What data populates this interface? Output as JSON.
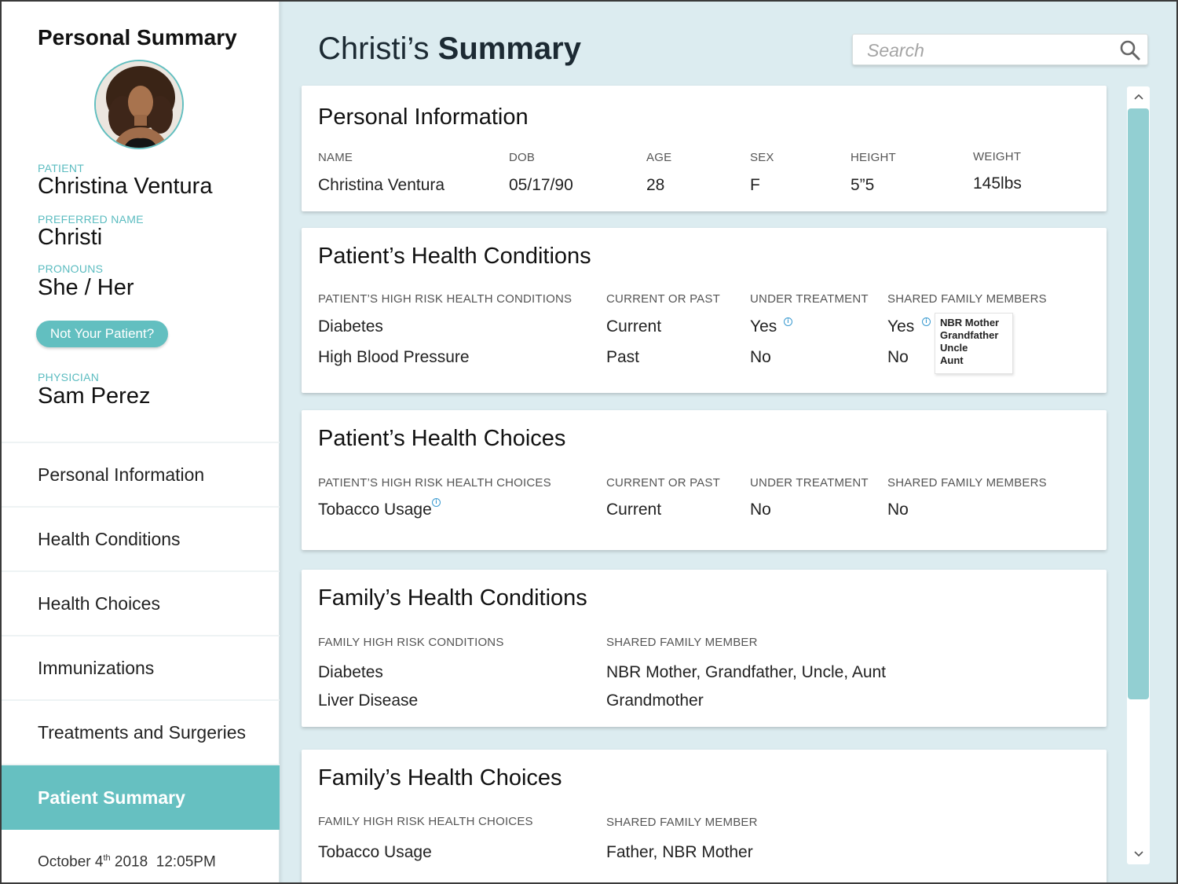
{
  "sidebar": {
    "title": "Personal Summary",
    "patient_label": "PATIENT",
    "patient_name": "Christina Ventura",
    "preferred_label": "PREFERRED NAME",
    "preferred_name": "Christi",
    "pronouns_label": "PRONOUNS",
    "pronouns": "She / Her",
    "not_your_patient": "Not Your Patient?",
    "physician_label": "PHYSICIAN",
    "physician": "Sam Perez",
    "nav": [
      {
        "label": "Personal Information",
        "active": false
      },
      {
        "label": "Health Conditions",
        "active": false
      },
      {
        "label": "Health Choices",
        "active": false
      },
      {
        "label": "Immunizations",
        "active": false
      },
      {
        "label": "Treatments and Surgeries",
        "active": false
      },
      {
        "label": "Patient Summary",
        "active": true
      }
    ],
    "timestamp": {
      "month": "October",
      "day": "4",
      "day_suffix": "th",
      "year": "2018",
      "time": "12:05PM"
    }
  },
  "header": {
    "title_prefix": "Christi’s",
    "title_bold": "Summary",
    "search_placeholder": "Search"
  },
  "personal_info": {
    "title": "Personal Information",
    "headers": [
      "NAME",
      "DOB",
      "AGE",
      "SEX",
      "HEIGHT",
      "WEIGHT"
    ],
    "values": [
      "Christina Ventura",
      "05/17/90",
      "28",
      "F",
      "5”5",
      "145lbs"
    ]
  },
  "health_conditions": {
    "title": "Patient’s Health Conditions",
    "headers": [
      "PATIENT’S HIGH RISK HEALTH CONDITIONS",
      "CURRENT OR PAST",
      "UNDER TREATMENT",
      "SHARED FAMILY MEMBERS"
    ],
    "rows": [
      [
        "Diabetes",
        "Current",
        "Yes",
        "Yes"
      ],
      [
        "High Blood Pressure",
        "Past",
        "No",
        "No"
      ]
    ],
    "tooltip": [
      "NBR Mother",
      "Grandfather",
      "Uncle",
      "Aunt"
    ]
  },
  "health_choices": {
    "title": "Patient’s Health Choices",
    "headers": [
      "PATIENT’S HIGH RISK HEALTH CHOICES",
      "CURRENT OR PAST",
      "UNDER TREATMENT",
      "SHARED FAMILY MEMBERS"
    ],
    "rows": [
      [
        "Tobacco Usage",
        "Current",
        "No",
        "No"
      ]
    ]
  },
  "family_conditions": {
    "title": "Family’s Health Conditions",
    "headers": [
      "FAMILY HIGH RISK CONDITIONS",
      "SHARED FAMILY MEMBER"
    ],
    "rows": [
      [
        "Diabetes",
        "NBR Mother, Grandfather, Uncle, Aunt"
      ],
      [
        "Liver Disease",
        "Grandmother"
      ]
    ]
  },
  "family_choices": {
    "title": "Family’s Health Choices",
    "headers": [
      "FAMILY HIGH RISK HEALTH CHOICES",
      "SHARED FAMILY MEMBER"
    ],
    "rows": [
      [
        "Tobacco Usage",
        "Father, NBR Mother"
      ]
    ]
  },
  "icons": {
    "search": "search-icon",
    "info": "info-icon",
    "scroll_up": "chevron-up-icon",
    "scroll_down": "chevron-down-icon"
  },
  "colors": {
    "accent": "#62bfc0",
    "background": "#dcecf0",
    "info": "#3a9ad0",
    "scroll_thumb": "#92cfd2"
  }
}
